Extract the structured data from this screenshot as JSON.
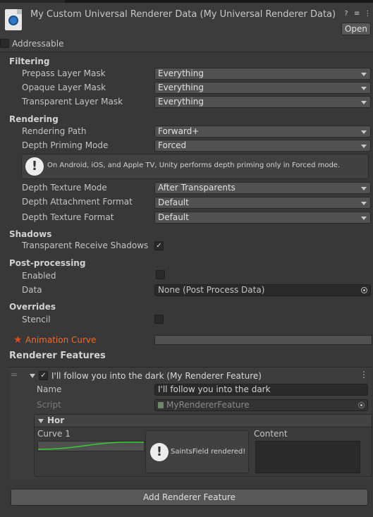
{
  "header": {
    "title": "My Custom Universal Renderer Data (My Universal Renderer Data)",
    "help_icon": "?",
    "settings_icon": "≡",
    "menu_icon": "⋮",
    "open_label": "Open"
  },
  "addressable": {
    "label": "Addressable",
    "checked": false
  },
  "filtering": {
    "section": "Filtering",
    "prepass_label": "Prepass Layer Mask",
    "prepass_value": "Everything",
    "opaque_label": "Opaque Layer Mask",
    "opaque_value": "Everything",
    "transparent_label": "Transparent Layer Mask",
    "transparent_value": "Everything"
  },
  "rendering": {
    "section": "Rendering",
    "path_label": "Rendering Path",
    "path_value": "Forward+",
    "priming_label": "Depth Priming Mode",
    "priming_value": "Forced",
    "help_icon": "!",
    "help_text": "On Android, iOS, and Apple TV, Unity performs depth priming only in Forced mode.",
    "depth_tex_mode_label": "Depth Texture Mode",
    "depth_tex_mode_value": "After Transparents",
    "depth_attach_label": "Depth Attachment Format",
    "depth_attach_value": "Default",
    "depth_tex_format_label": "Depth Texture Format",
    "depth_tex_format_value": "Default"
  },
  "shadows": {
    "section": "Shadows",
    "transparent_receive_label": "Transparent Receive Shadows",
    "transparent_receive_check": "✓"
  },
  "postprocessing": {
    "section": "Post-processing",
    "enabled_label": "Enabled",
    "data_label": "Data",
    "data_value": "None (Post Process Data)"
  },
  "overrides": {
    "section": "Overrides",
    "stencil_label": "Stencil"
  },
  "animation_curve": {
    "star_icon": "★",
    "label": "Animation Curve",
    "label_color": "#f26a2c"
  },
  "features": {
    "section": "Renderer Features",
    "drag_handle": "=",
    "item_check": "✓",
    "item_title": "I'll follow you into the dark (My Renderer Feature)",
    "item_menu": "⋮",
    "name_label": "Name",
    "name_value": "I'll follow you into the dark",
    "script_label": "Script",
    "script_value": "MyRendererFeature",
    "hor_title": "Hor",
    "curve_label": "Curve 1",
    "curve_color": "#33cc33",
    "saints_icon": "!",
    "saints_text": "SaintsField rendered!",
    "content_label": "Content",
    "add_button": "Add Renderer Feature"
  }
}
